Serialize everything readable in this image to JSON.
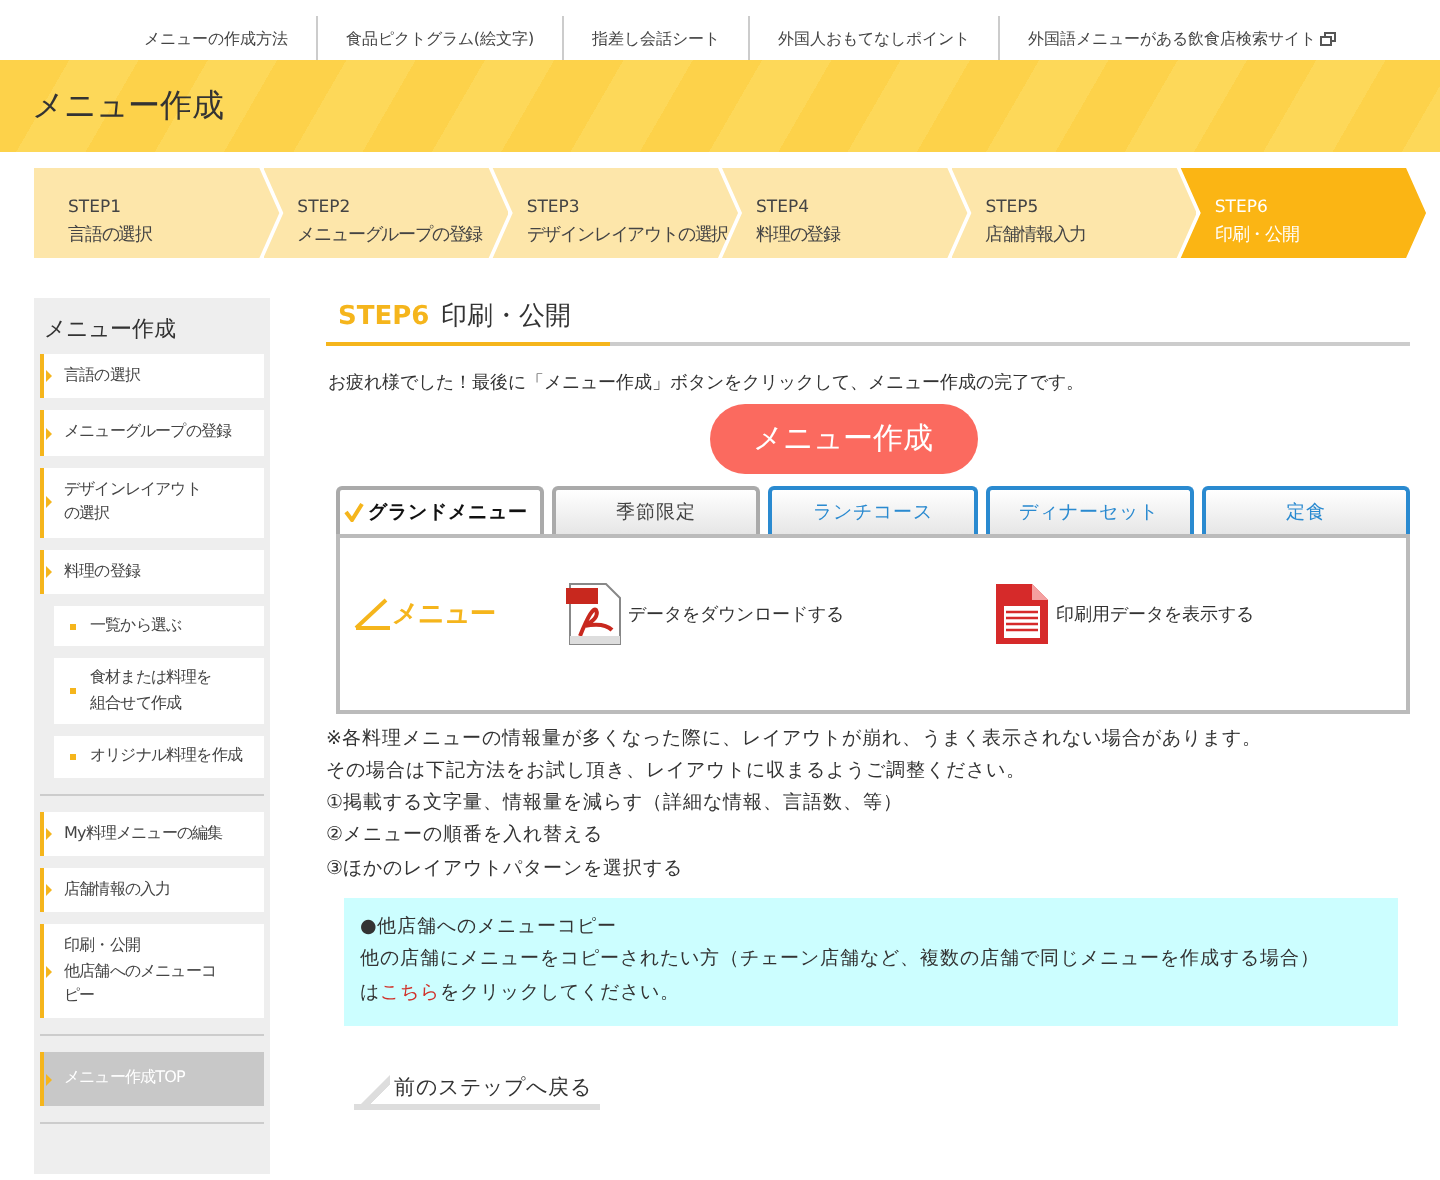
{
  "top_nav": [
    {
      "label": "メニューの作成方法",
      "external": false
    },
    {
      "label": "食品ピクトグラム(絵文字)",
      "external": false
    },
    {
      "label": "指差し会話シート",
      "external": false
    },
    {
      "label": "外国人おもてなしポイント",
      "external": false
    },
    {
      "label": "外国語メニューがある飲食店検索サイト",
      "external": true
    }
  ],
  "header": {
    "title": "メニュー作成"
  },
  "steps": [
    {
      "step": "STEP1",
      "label": "言語の選択",
      "selected": false
    },
    {
      "step": "STEP2",
      "label": "メニューグループの登録",
      "selected": false
    },
    {
      "step": "STEP3",
      "label": "デザインレイアウトの選択",
      "selected": false
    },
    {
      "step": "STEP4",
      "label": "料理の登録",
      "selected": false
    },
    {
      "step": "STEP5",
      "label": "店舗情報入力",
      "selected": false
    },
    {
      "step": "STEP6",
      "label": "印刷・公開",
      "selected": true
    }
  ],
  "sidebar": {
    "title": "メニュー作成",
    "sections": [
      [
        {
          "lines": [
            "言語の選択"
          ]
        },
        {
          "lines": [
            "メニューグループの登録"
          ]
        },
        {
          "lines": [
            "デザインレイアウト",
            "の選択"
          ]
        },
        {
          "lines": [
            "料理の登録"
          ],
          "children": [
            {
              "lines": [
                "一覧から選ぶ"
              ]
            },
            {
              "lines": [
                "食材または料理を",
                "組合せて作成"
              ]
            },
            {
              "lines": [
                "オリジナル料理を作成"
              ]
            }
          ]
        }
      ],
      [
        {
          "lines": [
            "My料理メニューの編集"
          ]
        },
        {
          "lines": [
            "店舗情報の入力"
          ]
        },
        {
          "lines": [
            "印刷・公開",
            "他店舗へのメニューコ",
            "ピー"
          ]
        }
      ],
      [
        {
          "lines": [
            "メニュー作成TOP"
          ],
          "kind": "top"
        }
      ]
    ]
  },
  "main": {
    "step": "STEP6",
    "title": "印刷・公開",
    "intro": "お疲れ様でした！最後に「メニュー作成」ボタンをクリックして、メニュー作成の完了です。",
    "create_button": "メニュー作成",
    "tabs": [
      {
        "label": "グランドメニュー",
        "selected": true,
        "disabled": false
      },
      {
        "label": "季節限定",
        "selected": false,
        "disabled": true
      },
      {
        "label": "ランチコース",
        "selected": false,
        "disabled": false
      },
      {
        "label": "ディナーセット",
        "selected": false,
        "disabled": false
      },
      {
        "label": "定食",
        "selected": false,
        "disabled": false
      }
    ],
    "panel": {
      "logo": "メニュー",
      "actions": [
        {
          "label": "データをダウンロードする",
          "kind": "adobe"
        },
        {
          "label": "印刷用データを表示する",
          "kind": "document"
        }
      ]
    },
    "notes": [
      "※各料理メニューの情報量が多くなった際に、レイアウトが崩れ、うまく表示されない場合があります。",
      "その場合は下記方法をお試し頂き、レイアウトに収まるようご調整ください。",
      "①掲載する文字量、情報量を減らす（詳細な情報、言語数、等）",
      "②メニューの順番を入れ替える",
      "③ほかのレイアウトパターンを選択する"
    ],
    "copy_box": {
      "heading": "●他店舗へのメニューコピー",
      "first_line": "他の店舗にメニューをコピーされたい方（チェーン店舗など、複数の店舗で同じメニューを作成する場合）",
      "text_before": "は",
      "link": "こちら",
      "text_after": "をクリックしてください。"
    },
    "back_link": "前のステップへ戻る"
  }
}
